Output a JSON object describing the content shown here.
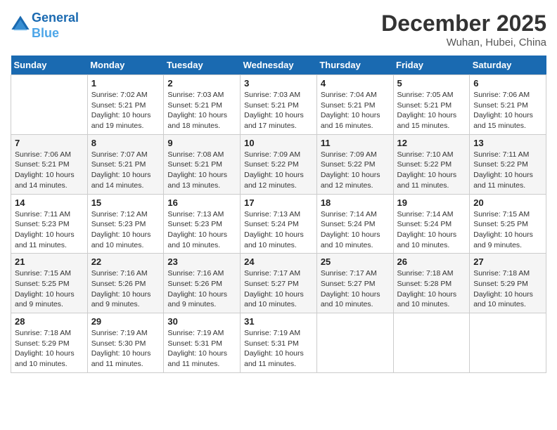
{
  "logo": {
    "line1": "General",
    "line2": "Blue"
  },
  "title": "December 2025",
  "location": "Wuhan, Hubei, China",
  "weekdays": [
    "Sunday",
    "Monday",
    "Tuesday",
    "Wednesday",
    "Thursday",
    "Friday",
    "Saturday"
  ],
  "weeks": [
    [
      {
        "day": "",
        "info": ""
      },
      {
        "day": "1",
        "info": "Sunrise: 7:02 AM\nSunset: 5:21 PM\nDaylight: 10 hours\nand 19 minutes."
      },
      {
        "day": "2",
        "info": "Sunrise: 7:03 AM\nSunset: 5:21 PM\nDaylight: 10 hours\nand 18 minutes."
      },
      {
        "day": "3",
        "info": "Sunrise: 7:03 AM\nSunset: 5:21 PM\nDaylight: 10 hours\nand 17 minutes."
      },
      {
        "day": "4",
        "info": "Sunrise: 7:04 AM\nSunset: 5:21 PM\nDaylight: 10 hours\nand 16 minutes."
      },
      {
        "day": "5",
        "info": "Sunrise: 7:05 AM\nSunset: 5:21 PM\nDaylight: 10 hours\nand 15 minutes."
      },
      {
        "day": "6",
        "info": "Sunrise: 7:06 AM\nSunset: 5:21 PM\nDaylight: 10 hours\nand 15 minutes."
      }
    ],
    [
      {
        "day": "7",
        "info": "Sunrise: 7:06 AM\nSunset: 5:21 PM\nDaylight: 10 hours\nand 14 minutes."
      },
      {
        "day": "8",
        "info": "Sunrise: 7:07 AM\nSunset: 5:21 PM\nDaylight: 10 hours\nand 14 minutes."
      },
      {
        "day": "9",
        "info": "Sunrise: 7:08 AM\nSunset: 5:21 PM\nDaylight: 10 hours\nand 13 minutes."
      },
      {
        "day": "10",
        "info": "Sunrise: 7:09 AM\nSunset: 5:22 PM\nDaylight: 10 hours\nand 12 minutes."
      },
      {
        "day": "11",
        "info": "Sunrise: 7:09 AM\nSunset: 5:22 PM\nDaylight: 10 hours\nand 12 minutes."
      },
      {
        "day": "12",
        "info": "Sunrise: 7:10 AM\nSunset: 5:22 PM\nDaylight: 10 hours\nand 11 minutes."
      },
      {
        "day": "13",
        "info": "Sunrise: 7:11 AM\nSunset: 5:22 PM\nDaylight: 10 hours\nand 11 minutes."
      }
    ],
    [
      {
        "day": "14",
        "info": "Sunrise: 7:11 AM\nSunset: 5:23 PM\nDaylight: 10 hours\nand 11 minutes."
      },
      {
        "day": "15",
        "info": "Sunrise: 7:12 AM\nSunset: 5:23 PM\nDaylight: 10 hours\nand 10 minutes."
      },
      {
        "day": "16",
        "info": "Sunrise: 7:13 AM\nSunset: 5:23 PM\nDaylight: 10 hours\nand 10 minutes."
      },
      {
        "day": "17",
        "info": "Sunrise: 7:13 AM\nSunset: 5:24 PM\nDaylight: 10 hours\nand 10 minutes."
      },
      {
        "day": "18",
        "info": "Sunrise: 7:14 AM\nSunset: 5:24 PM\nDaylight: 10 hours\nand 10 minutes."
      },
      {
        "day": "19",
        "info": "Sunrise: 7:14 AM\nSunset: 5:24 PM\nDaylight: 10 hours\nand 10 minutes."
      },
      {
        "day": "20",
        "info": "Sunrise: 7:15 AM\nSunset: 5:25 PM\nDaylight: 10 hours\nand 9 minutes."
      }
    ],
    [
      {
        "day": "21",
        "info": "Sunrise: 7:15 AM\nSunset: 5:25 PM\nDaylight: 10 hours\nand 9 minutes."
      },
      {
        "day": "22",
        "info": "Sunrise: 7:16 AM\nSunset: 5:26 PM\nDaylight: 10 hours\nand 9 minutes."
      },
      {
        "day": "23",
        "info": "Sunrise: 7:16 AM\nSunset: 5:26 PM\nDaylight: 10 hours\nand 9 minutes."
      },
      {
        "day": "24",
        "info": "Sunrise: 7:17 AM\nSunset: 5:27 PM\nDaylight: 10 hours\nand 10 minutes."
      },
      {
        "day": "25",
        "info": "Sunrise: 7:17 AM\nSunset: 5:27 PM\nDaylight: 10 hours\nand 10 minutes."
      },
      {
        "day": "26",
        "info": "Sunrise: 7:18 AM\nSunset: 5:28 PM\nDaylight: 10 hours\nand 10 minutes."
      },
      {
        "day": "27",
        "info": "Sunrise: 7:18 AM\nSunset: 5:29 PM\nDaylight: 10 hours\nand 10 minutes."
      }
    ],
    [
      {
        "day": "28",
        "info": "Sunrise: 7:18 AM\nSunset: 5:29 PM\nDaylight: 10 hours\nand 10 minutes."
      },
      {
        "day": "29",
        "info": "Sunrise: 7:19 AM\nSunset: 5:30 PM\nDaylight: 10 hours\nand 11 minutes."
      },
      {
        "day": "30",
        "info": "Sunrise: 7:19 AM\nSunset: 5:31 PM\nDaylight: 10 hours\nand 11 minutes."
      },
      {
        "day": "31",
        "info": "Sunrise: 7:19 AM\nSunset: 5:31 PM\nDaylight: 10 hours\nand 11 minutes."
      },
      {
        "day": "",
        "info": ""
      },
      {
        "day": "",
        "info": ""
      },
      {
        "day": "",
        "info": ""
      }
    ]
  ]
}
